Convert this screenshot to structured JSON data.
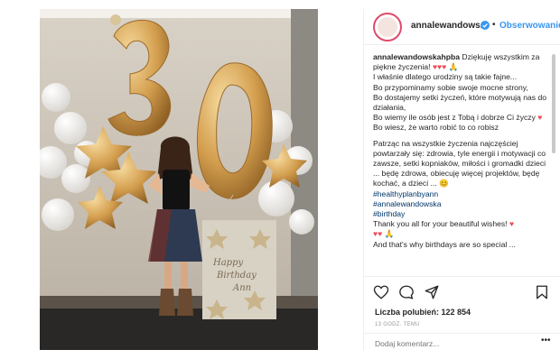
{
  "post": {
    "account": {
      "handle": "annalewandows...",
      "verified": true,
      "separator": "•",
      "follow_label": "Obserwowanie"
    },
    "photo": {
      "balloon_number": "30",
      "card_text": [
        "Happy",
        "Birthday",
        "Ann"
      ]
    },
    "caption": {
      "username": "annalewandowskahpba",
      "paragraphs": [
        "Dziękuję wszystkim za piękne życzenia!",
        "I właśnie dlatego urodziny są takie fajne...",
        "Bo przypominamy sobie swoje mocne strony,",
        "Bo dostajemy setki życzeń, które motywują nas do działania,",
        "Bo wiemy ile osób jest z Tobą i dobrze Ci życzy",
        "Bo wiesz, że warto robić to co robisz",
        "Patrząc na wszystkie życzenia najczęściej powtarzały się: zdrowia, tyle energii i motywacji co zawsze, setki kopniaków, miłości i gromadki dzieci ... będę zdrowa, obiecuję więcej projektów, będę kochać, a dzieci ...",
        "Thank you all for your beautiful wishes!",
        "And that's why birthdays are so special ..."
      ],
      "hashtags": [
        "#healthyplanbyann",
        "#annalewandowska",
        "#birthday"
      ]
    },
    "likes_label": "Liczba polubień: 122 854",
    "timestamp": "13 GODZ. TEMU",
    "comment_placeholder": "Dodaj komentarz...",
    "more_label": "•••",
    "icons": [
      "heart-icon",
      "comment-icon",
      "share-icon",
      "bookmark-icon",
      "verified-icon"
    ],
    "colors": {
      "link": "#3897f0",
      "heart": "#ed4956",
      "verified": "#3897f0",
      "gold": "#d4a04a"
    }
  }
}
